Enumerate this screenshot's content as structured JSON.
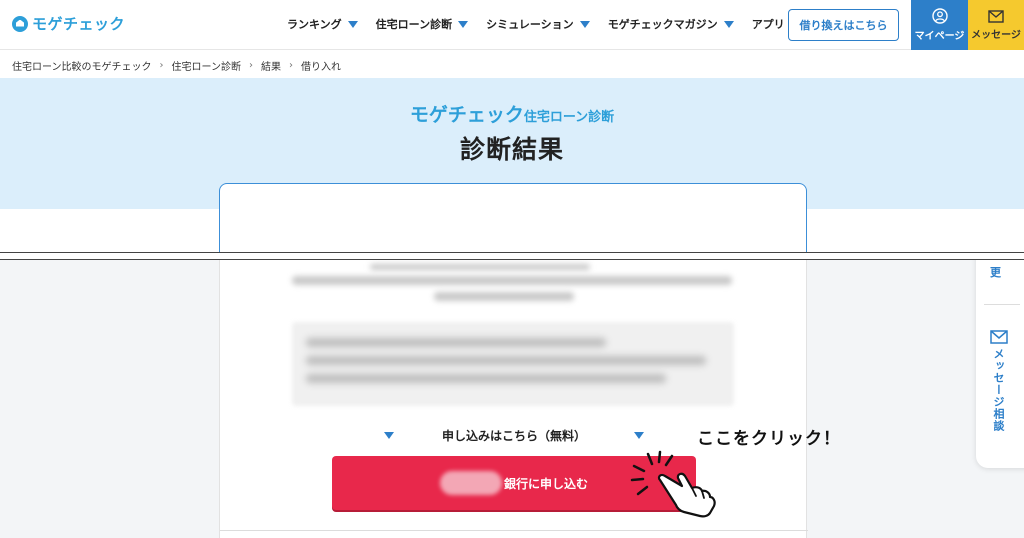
{
  "header": {
    "logo_text": "モゲチェック",
    "nav": [
      {
        "label": "ランキング"
      },
      {
        "label": "住宅ローン診断"
      },
      {
        "label": "シミュレーション"
      },
      {
        "label": "モゲチェックマガジン"
      },
      {
        "label": "アプリ"
      }
    ],
    "refinance_button": "借り換えはこちら",
    "mypage_label": "マイページ",
    "message_label": "メッセージ"
  },
  "breadcrumb": [
    "住宅ローン比較のモゲチェック",
    "住宅ローン診断",
    "結果",
    "借り入れ"
  ],
  "hero": {
    "brand": "モゲチェック",
    "brand_sub": "住宅ローン診断",
    "title": "診断結果"
  },
  "apply_section": {
    "heading": "申し込みはこちら（無料）",
    "button_label": "銀行に申し込む",
    "annotation": "ここをクリック！"
  },
  "side_panel": {
    "change_label": "更",
    "message_label": "メッセージ相談"
  },
  "colors": {
    "brand_blue": "#2d9fd9",
    "nav_blue": "#2d7fc9",
    "message_yellow": "#f5c92e",
    "apply_red": "#e8284b",
    "hero_bg": "#dbeefb"
  }
}
